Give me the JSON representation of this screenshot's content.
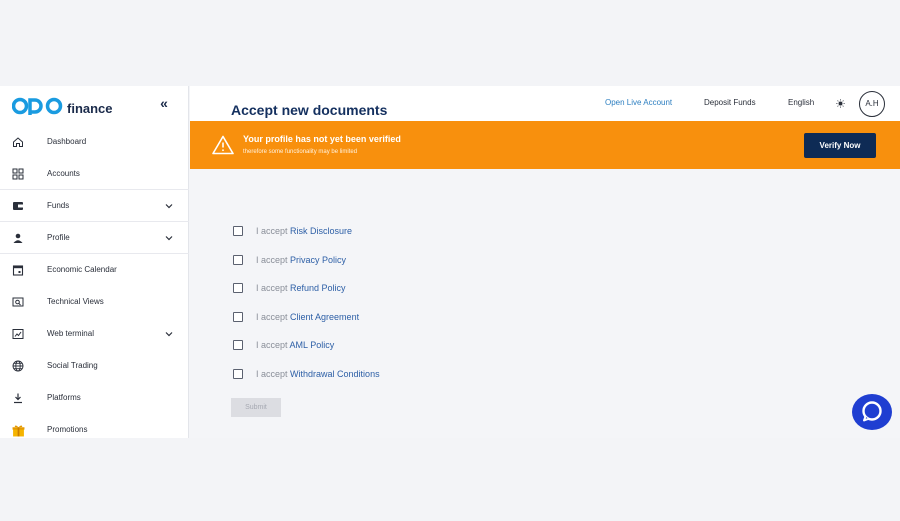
{
  "brand": {
    "word": "finance",
    "colors": {
      "primary": "#0e2b55",
      "accent": "#1a9be0",
      "warning": "#f8900d",
      "chat": "#1f3ed1"
    }
  },
  "sidebar": {
    "items": [
      {
        "label": "Dashboard",
        "icon": "home-icon",
        "has_chevron": false
      },
      {
        "label": "Accounts",
        "icon": "grid-icon",
        "has_chevron": false
      },
      {
        "label": "Funds",
        "icon": "wallet-icon",
        "has_chevron": true
      },
      {
        "label": "Profile",
        "icon": "user-icon",
        "has_chevron": true
      },
      {
        "label": "Economic Calendar",
        "icon": "calendar-icon",
        "has_chevron": false
      },
      {
        "label": "Technical Views",
        "icon": "chart-search-icon",
        "has_chevron": false
      },
      {
        "label": "Web terminal",
        "icon": "terminal-icon",
        "has_chevron": true
      },
      {
        "label": "Social Trading",
        "icon": "globe-icon",
        "has_chevron": false
      },
      {
        "label": "Platforms",
        "icon": "download-icon",
        "has_chevron": false
      },
      {
        "label": "Promotions",
        "icon": "gift-icon",
        "has_chevron": false
      }
    ]
  },
  "topbar": {
    "open_live_account": "Open Live Account",
    "deposit_funds": "Deposit Funds",
    "language": "English",
    "avatar_initials": "A.H"
  },
  "banner": {
    "title": "Your profile has not yet been verified",
    "subtitle": "therefore some functionality may be limited",
    "button": "Verify Now"
  },
  "main": {
    "title": "Accept new documents",
    "prefix": "I accept ",
    "documents": [
      {
        "name": "Risk Disclosure",
        "checked": false
      },
      {
        "name": "Privacy Policy",
        "checked": false
      },
      {
        "name": "Refund Policy",
        "checked": false
      },
      {
        "name": "Client Agreement",
        "checked": false
      },
      {
        "name": "AML Policy",
        "checked": false
      },
      {
        "name": "Withdrawal Conditions",
        "checked": false
      }
    ],
    "submit": "Submit"
  }
}
